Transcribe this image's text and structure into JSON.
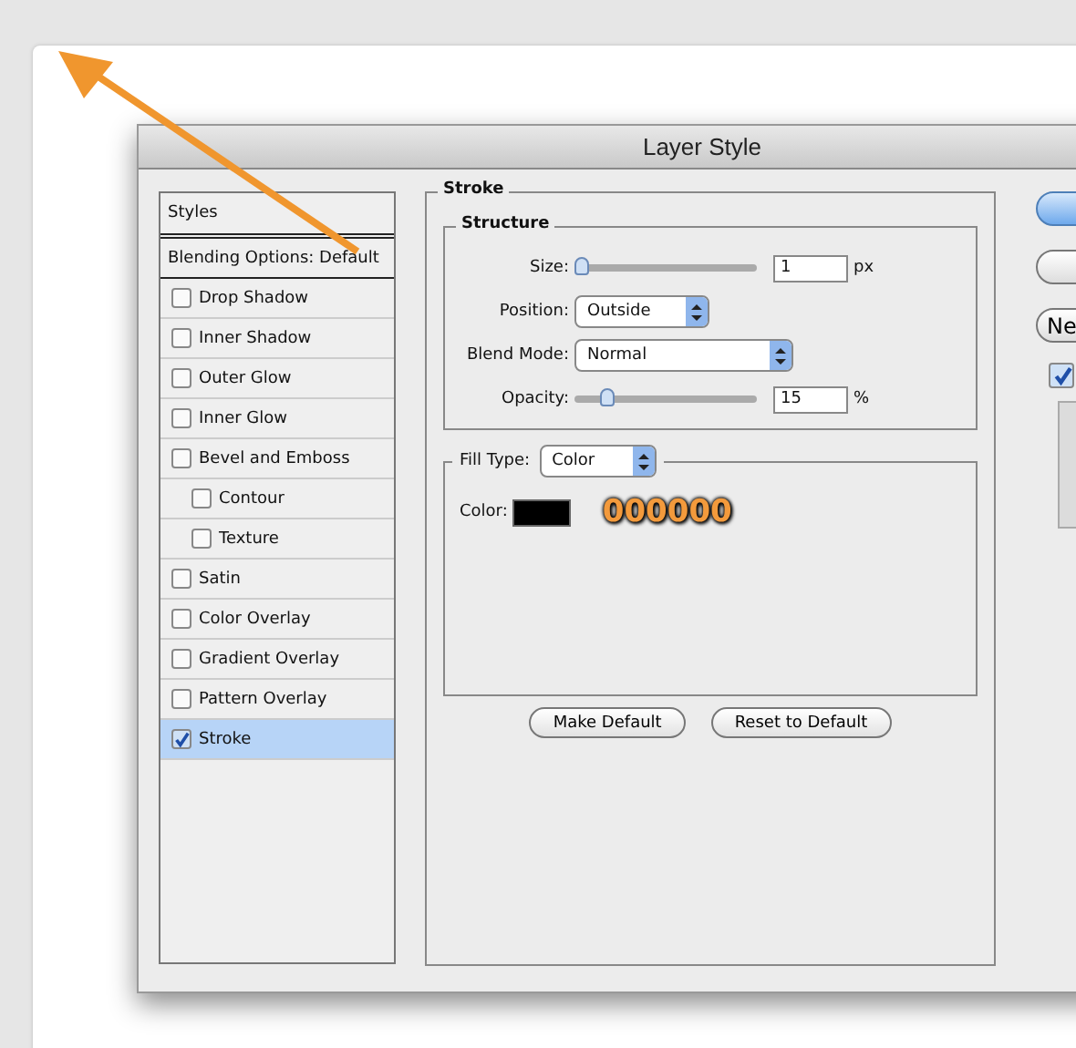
{
  "window": {
    "title": "Layer Style"
  },
  "styles_panel": {
    "header": "Styles",
    "blending_options": "Blending Options: Default",
    "items": [
      {
        "label": "Drop Shadow",
        "checked": false,
        "selected": false
      },
      {
        "label": "Inner Shadow",
        "checked": false,
        "selected": false
      },
      {
        "label": "Outer Glow",
        "checked": false,
        "selected": false
      },
      {
        "label": "Inner Glow",
        "checked": false,
        "selected": false
      },
      {
        "label": "Bevel and Emboss",
        "checked": false,
        "selected": false,
        "children": [
          {
            "label": "Contour",
            "checked": false,
            "selected": false
          },
          {
            "label": "Texture",
            "checked": false,
            "selected": false
          }
        ]
      },
      {
        "label": "Satin",
        "checked": false,
        "selected": false
      },
      {
        "label": "Color Overlay",
        "checked": false,
        "selected": false
      },
      {
        "label": "Gradient Overlay",
        "checked": false,
        "selected": false
      },
      {
        "label": "Pattern Overlay",
        "checked": false,
        "selected": false
      },
      {
        "label": "Stroke",
        "checked": true,
        "selected": true
      }
    ]
  },
  "stroke": {
    "title": "Stroke",
    "structure": {
      "title": "Structure",
      "size": {
        "label": "Size:",
        "level": 0,
        "value": "1",
        "unit": "px"
      },
      "position": {
        "label": "Position:",
        "value": "Outside"
      },
      "blend_mode": {
        "label": "Blend Mode:",
        "value": "Normal"
      },
      "opacity": {
        "label": "Opacity:",
        "level": 0.15,
        "value": "15",
        "unit": "%"
      }
    },
    "fill": {
      "label": "Fill Type:",
      "value": "Color",
      "color_label": "Color:",
      "color": "#000000",
      "annotation": "000000"
    }
  },
  "buttons": [
    {
      "label": "Make Default"
    },
    {
      "label": "Reset to Default"
    }
  ],
  "side_controls": [
    {
      "kind": "default-button"
    },
    {
      "kind": "button"
    },
    {
      "kind": "button",
      "label": "Ne"
    },
    {
      "kind": "checkbox",
      "checked": true
    },
    {
      "kind": "preview"
    }
  ]
}
